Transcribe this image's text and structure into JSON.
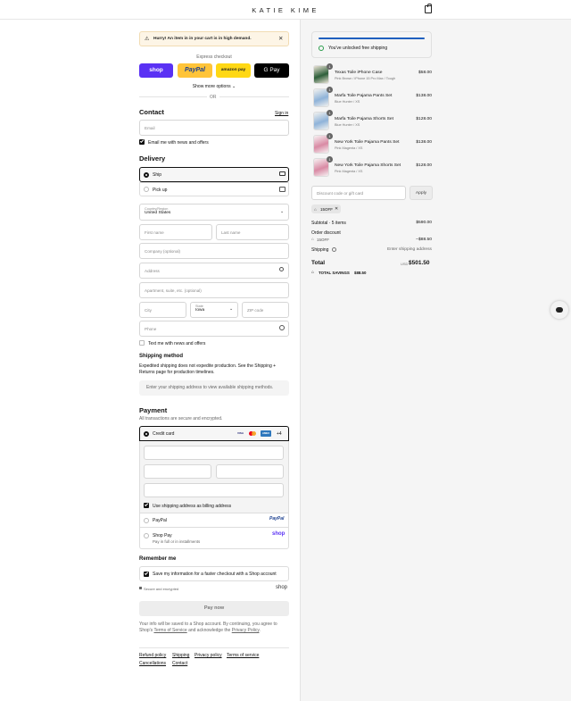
{
  "header": {
    "brand": "KATIE KIME"
  },
  "alert": {
    "text": "Hurry! An item in in your cart is in high demand.",
    "icon": "warning-icon"
  },
  "express": {
    "title": "Express checkout",
    "shop_label": "shop",
    "paypal_label": "PayPal",
    "amazon_label": "amazon pay",
    "gpay_label": "G Pay",
    "show_more": "Show more options",
    "or": "OR"
  },
  "contact": {
    "title": "Contact",
    "sign_in": "Sign in",
    "email_placeholder": "Email",
    "newsletter": "Email me with news and offers"
  },
  "delivery": {
    "title": "Delivery",
    "ship": "Ship",
    "pickup": "Pick up",
    "country_label": "Country/Region",
    "country_value": "United States",
    "first_name": "First name",
    "last_name": "Last name",
    "company": "Company (optional)",
    "address": "Address",
    "apartment": "Apartment, suite, etc. (optional)",
    "city": "City",
    "state_label": "State",
    "state_value": "Iowa",
    "zip": "ZIP code",
    "phone": "Phone",
    "text_offers": "Text me with news and offers"
  },
  "shipping_method": {
    "title": "Shipping method",
    "note": "Expedited shipping does not expedite production. See the Shipping + Returns page for production timelines.",
    "placeholder": "Enter your shipping address to view available shipping methods."
  },
  "payment": {
    "title": "Payment",
    "subtitle": "All transactions are secure and encrypted.",
    "credit_card": "Credit card",
    "card_brands": [
      "VISA",
      "MC",
      "AMEX"
    ],
    "more_brands": "+4",
    "billing_same": "Use shipping address as billing address",
    "paypal": "PayPal",
    "shop_pay": "Shop Pay",
    "shop_pay_sub": "Pay in full or in installments",
    "shop_logo": "shop",
    "paypal_logo": "PayPal"
  },
  "remember": {
    "title": "Remember me",
    "save_info": "Save my information for a faster checkout with a Shop account",
    "secure": "Secure and encrypted",
    "shop_logo": "shop"
  },
  "pay_now": "Pay now",
  "legal": {
    "prefix": "Your info will be saved to a Shop account. By continuing, you agree to Shop's",
    "terms": "Terms of Service",
    "middle": "and acknowledge the",
    "privacy": "Privacy Policy",
    "suffix": "."
  },
  "footer_links": [
    "Refund policy",
    "Shipping",
    "Privacy policy",
    "Terms of service",
    "Cancellations",
    "Contact"
  ],
  "summary": {
    "free_shipping": "You've unlocked free shipping",
    "progress": 1.0,
    "items": [
      {
        "name": "Texas Toile iPhone Case",
        "variant": "Pink Brown / iPhone 15 Pro Max / Tough",
        "price": "$58.00",
        "qty": "1"
      },
      {
        "name": "Marfa Toile Pajama Pants Set",
        "variant": "Blue Hunter / XS",
        "price": "$138.00",
        "qty": "1"
      },
      {
        "name": "Marfa Toile Pajama Shorts Set",
        "variant": "Blue Hunter / XS",
        "price": "$128.00",
        "qty": "1"
      },
      {
        "name": "New York Toile Pajama Pants Set",
        "variant": "Pink Magenta / XS",
        "price": "$138.00",
        "qty": "1"
      },
      {
        "name": "New York Toile Pajama Shorts Set",
        "variant": "Pink Magenta / XS",
        "price": "$128.00",
        "qty": "1"
      }
    ],
    "discount_placeholder": "Discount code or gift card",
    "apply": "Apply",
    "applied_code": "15OFF",
    "subtotal_label": "Subtotal · 5 items",
    "subtotal": "$590.00",
    "order_discount": "Order discount",
    "discount_code": "15OFF",
    "discount_amount": "−$88.50",
    "shipping_label": "Shipping",
    "shipping_value": "Enter shipping address",
    "total_label": "Total",
    "currency": "USD",
    "total": "$501.50",
    "savings_label": "TOTAL SAVINGS",
    "savings": "$88.50"
  },
  "colors": {
    "shop_purple": "#5a31f4",
    "paypal_yellow": "#ffc439",
    "amazon_yellow": "#ffd814",
    "progress_blue": "#1f5fbf",
    "alert_bg": "#fdf5e6"
  }
}
